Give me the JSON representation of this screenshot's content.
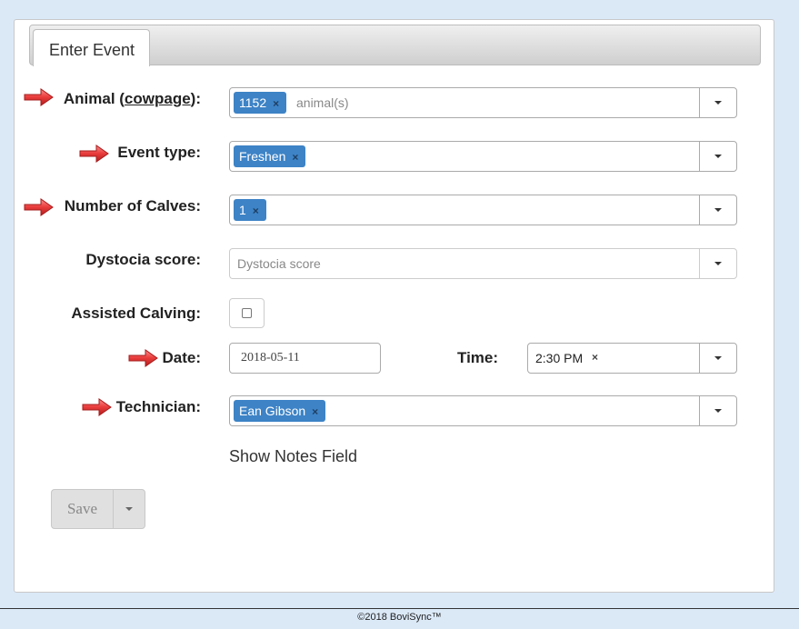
{
  "tab": {
    "label": "Enter Event"
  },
  "animal": {
    "label_prefix": "Animal (",
    "label_link": "cowpage",
    "label_suffix": "):",
    "tag": "1152",
    "placeholder": "animal(s)"
  },
  "event_type": {
    "label": "Event type:",
    "tag": "Freshen"
  },
  "number_of_calves": {
    "label": "Number of Calves:",
    "tag": "1"
  },
  "dystocia": {
    "label": "Dystocia score:",
    "placeholder": "Dystocia score"
  },
  "assisted_calving": {
    "label": "Assisted Calving:",
    "checked": false
  },
  "date": {
    "label": "Date:",
    "value": "2018-05-11"
  },
  "time": {
    "label": "Time:",
    "value": "2:30 PM"
  },
  "technician": {
    "label": "Technician:",
    "tag": "Ean Gibson"
  },
  "show_notes": "Show Notes Field",
  "save": {
    "label": "Save"
  },
  "remove_symbol": "×",
  "footer": "©2018 BoviSync™",
  "colors": {
    "tag_bg": "#3d83c6",
    "page_bg": "#dbe9f7",
    "arrow": "#e84545"
  }
}
